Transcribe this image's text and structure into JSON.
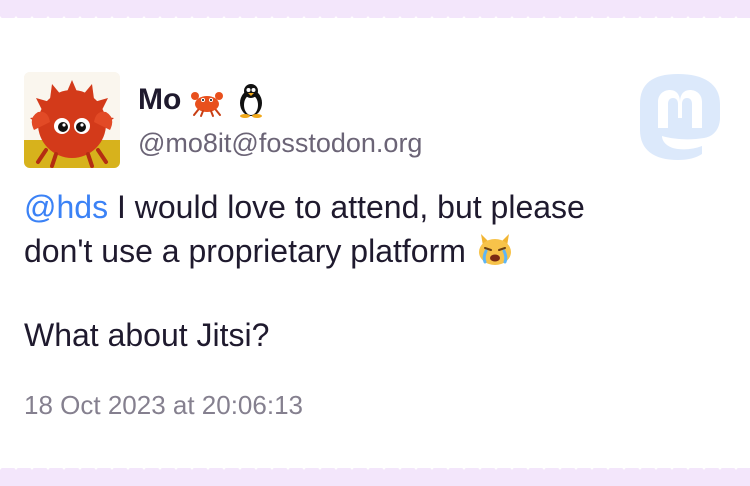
{
  "post": {
    "display_name": "Mo",
    "name_emojis": [
      "crab-emoji",
      "penguin-emoji"
    ],
    "handle": "@mo8it@fosstodon.org",
    "mention": "@hds",
    "line1_rest": " I would love to attend, but please",
    "line2": "don't use a proprietary platform",
    "line3": "What about Jitsi?",
    "timestamp": "18 Oct 2023 at 20:06:13"
  },
  "icons": {
    "avatar": "ferris-crab-avatar",
    "brand": "mastodon-logo",
    "emoji": "crying-cat-emoji"
  },
  "colors": {
    "background": "#f3e6fb",
    "card": "#ffffff",
    "text": "#1f1a2e",
    "mention": "#3b82f6",
    "muted": "#85808f",
    "logo": "#dce9fb"
  }
}
